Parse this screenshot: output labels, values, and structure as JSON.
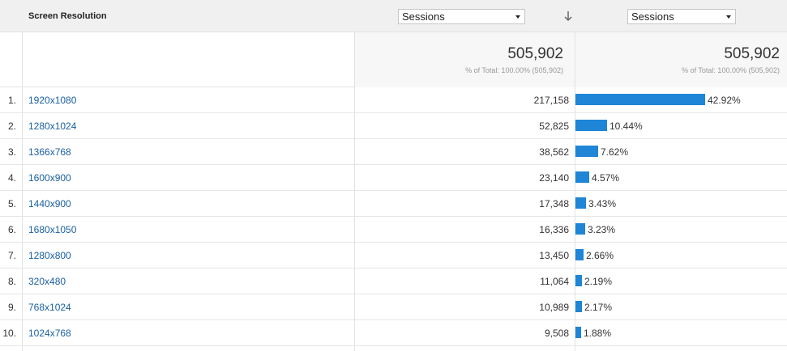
{
  "header": {
    "dimension_label": "Screen Resolution",
    "metric_select_left": "Sessions",
    "metric_select_right": "Sessions"
  },
  "totals": {
    "left_value": "505,902",
    "left_sub": "% of Total: 100.00% (505,902)",
    "right_value": "505,902",
    "right_sub": "% of Total: 100.00% (505,902)"
  },
  "colors": {
    "bar": "#1f85d6",
    "link": "#1a5fa0"
  },
  "rows": [
    {
      "index": "1.",
      "resolution": "1920x1080",
      "sessions": "217,158",
      "percent_label": "42.92%",
      "percent": 42.92
    },
    {
      "index": "2.",
      "resolution": "1280x1024",
      "sessions": "52,825",
      "percent_label": "10.44%",
      "percent": 10.44
    },
    {
      "index": "3.",
      "resolution": "1366x768",
      "sessions": "38,562",
      "percent_label": "7.62%",
      "percent": 7.62
    },
    {
      "index": "4.",
      "resolution": "1600x900",
      "sessions": "23,140",
      "percent_label": "4.57%",
      "percent": 4.57
    },
    {
      "index": "5.",
      "resolution": "1440x900",
      "sessions": "17,348",
      "percent_label": "3.43%",
      "percent": 3.43
    },
    {
      "index": "6.",
      "resolution": "1680x1050",
      "sessions": "16,336",
      "percent_label": "3.23%",
      "percent": 3.23
    },
    {
      "index": "7.",
      "resolution": "1280x800",
      "sessions": "13,450",
      "percent_label": "2.66%",
      "percent": 2.66
    },
    {
      "index": "8.",
      "resolution": "320x480",
      "sessions": "11,064",
      "percent_label": "2.19%",
      "percent": 2.19
    },
    {
      "index": "9.",
      "resolution": "768x1024",
      "sessions": "10,989",
      "percent_label": "2.17%",
      "percent": 2.17
    },
    {
      "index": "10.",
      "resolution": "1024x768",
      "sessions": "9,508",
      "percent_label": "1.88%",
      "percent": 1.88
    }
  ]
}
